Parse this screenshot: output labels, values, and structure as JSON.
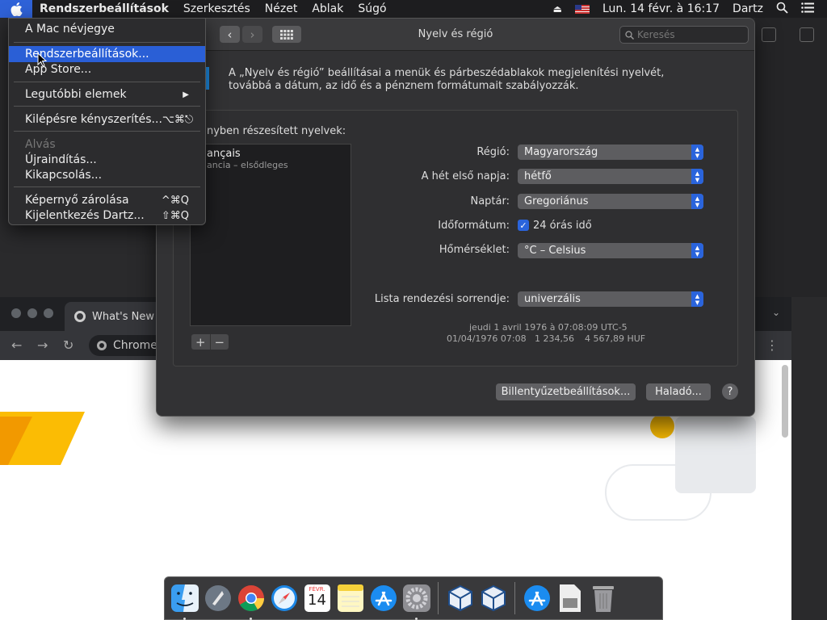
{
  "menubar": {
    "app_name": "Rendszerbeállítások",
    "items": [
      "Szerkesztés",
      "Nézet",
      "Ablak",
      "Súgó"
    ],
    "datetime": "Lun. 14 févr. à 16:17",
    "user": "Dartz"
  },
  "apple_menu": {
    "about": "A Mac névjegye",
    "system_prefs": "Rendszerbeállítások...",
    "app_store": "App Store...",
    "recent": "Legutóbbi elemek",
    "force_quit": "Kilépésre kényszerítés...",
    "force_quit_shortcut": "⌥⌘⎋",
    "sleep": "Alvás",
    "restart": "Újraindítás...",
    "shutdown": "Kikapcsolás...",
    "lock": "Képernyő zárolása",
    "lock_shortcut": "^⌘Q",
    "logout": "Kijelentkezés Dartz...",
    "logout_shortcut": "⇧⌘Q"
  },
  "prefs_window": {
    "title": "Nyelv és régió",
    "search_placeholder": "Keresés",
    "description": "A „Nyelv és régió” beállításai a menük és párbeszédablakok megjelenítési nyelvét, továbbá a dátum, az idő és a pénznem formátumait szabályozzák.",
    "languages_label": "nyben részesített nyelvek:",
    "language_name": "ançais",
    "language_sub": "ancia – elsődleges",
    "region_label": "Régió:",
    "region_value": "Magyarország",
    "first_day_label": "A hét első napja:",
    "first_day_value": "hétfő",
    "calendar_label": "Naptár:",
    "calendar_value": "Gregoriánus",
    "time_format_label": "Időformátum:",
    "time_format_value": "24 órás idő",
    "temperature_label": "Hőmérséklet:",
    "temperature_value": "°C – Celsius",
    "sort_label": "Lista rendezési sorrendje:",
    "sort_value": "univerzális",
    "sample_line1": "jeudi 1 avril 1976 à 07:08:09 UTC-5",
    "sample_line2_date": "01/04/1976 07:08",
    "sample_line2_num": "1 234,56",
    "sample_line2_cur": "4 567,89 HUF",
    "keyboard_button": "Billentyűzetbeállítások...",
    "advanced_button": "Haladó...",
    "help_button": "?"
  },
  "chrome": {
    "tab_title": "What's New",
    "omnibox": "Chrome"
  },
  "dock": {
    "calendar_month": "FÉVR.",
    "calendar_day": "14"
  },
  "colors": {
    "accent": "#2a64dc",
    "menubar": "#1d1d1f",
    "window": "#323234"
  }
}
